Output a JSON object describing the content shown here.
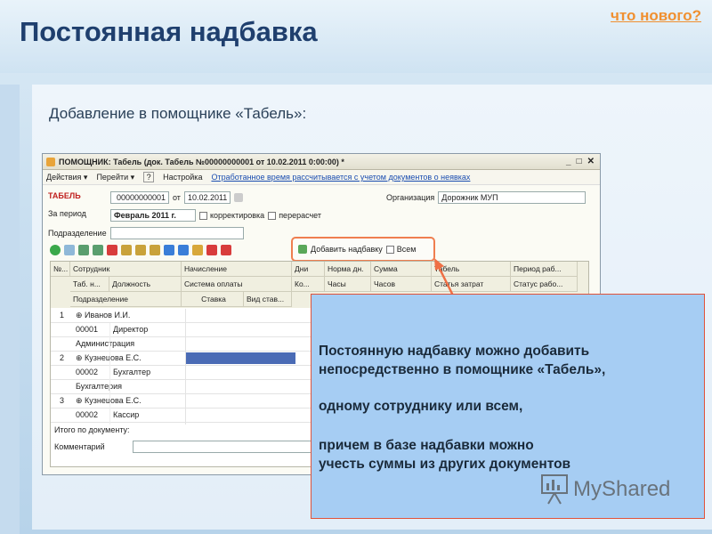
{
  "slide": {
    "title": "Постоянная надбавка",
    "whats_new": "что нового?",
    "subtitle": "Добавление в помощнике «Табель»:"
  },
  "window": {
    "title": "ПОМОЩНИК: Табель (док. Табель №00000000001 от 10.02.2011 0:00:00) *",
    "controls": [
      "_",
      "□",
      "✕"
    ],
    "menu": {
      "actions": "Действия ▾",
      "go": "Перейти ▾",
      "help": "?",
      "settings": "Настройка",
      "link": "Отработанное время рассчитывается с учетом документов о неявках"
    },
    "tabel_label": "ТАБЕЛЬ",
    "doc_number": "00000000001",
    "ot_label": "от",
    "doc_date": "10.02.2011",
    "org_label": "Организация",
    "org_value": "Дорожник МУП",
    "period_label": "За период",
    "period_value": "Февраль 2011 г.",
    "correction_label": "корректировка",
    "recalc_label": "перерасчет",
    "division_label": "Подразделение",
    "add_allowance_label": "Добавить надбавку",
    "all_label": "Всем",
    "columns_row1": [
      "№...",
      "Сотрудник",
      "Начисление",
      "Дни",
      "Норма дн.",
      "Сумма",
      "Табель",
      "Период раб..."
    ],
    "columns_row2": [
      "Таб. н...",
      "Должность",
      "Система оплаты",
      "Ко...",
      "Часы",
      "Часов",
      "",
      "Статья затрат",
      "Статус рабо..."
    ],
    "columns_row3": [
      "Подразделение",
      "Ставка",
      "Вид став..."
    ],
    "rows": [
      {
        "num": "1",
        "name": "Иванов И.И.",
        "tab": "00001",
        "position": "Директор",
        "dept": "Администрация"
      },
      {
        "num": "2",
        "name": "Кузнецова Е.С.",
        "tab": "00002",
        "position": "Бухгалтер",
        "dept": "Бухгалтерия"
      },
      {
        "num": "3",
        "name": "Кузнецова Е.С.",
        "tab": "00002",
        "position": "Кассир",
        "dept": ""
      }
    ],
    "total_label": "Итого по документу:",
    "comment_label": "Комментарий"
  },
  "callout": {
    "line1": "Постоянную надбавку можно добавить",
    "line2": "непосредственно в помощнике «Табель»,",
    "line3": "одному сотруднику или всем,",
    "line4": "причем в базе надбавки можно",
    "line5": "учесть суммы из других документов"
  },
  "watermark": "MyShared",
  "colors": {
    "title": "#1f3f6e",
    "accent": "#f09030",
    "callout_bg": "#a6cdf3",
    "highlight": "#ef7e4f"
  }
}
